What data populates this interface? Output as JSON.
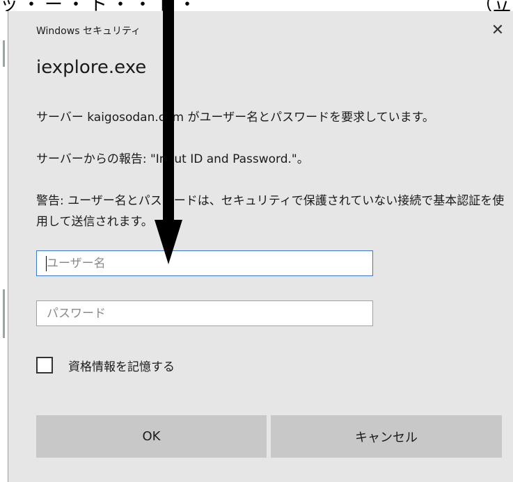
{
  "top_fragment": {
    "left_text": "ッ・ー・ト・・ト・",
    "right_text": "（立"
  },
  "dialog": {
    "app_title": "Windows セキュリティ",
    "close_glyph": "✕",
    "exe_title": "iexplore.exe",
    "message_1": "サーバー kaigosodan.com がユーザー名とパスワードを要求しています。",
    "message_2": "サーバーからの報告: \"Input ID and Password.\"。",
    "message_3": "警告: ユーザー名とパスワードは、セキュリティで保護されていない接続で基本認証を使用して送信されます。",
    "username": {
      "placeholder": "ユーザー名",
      "value": ""
    },
    "password": {
      "placeholder": "パスワード",
      "value": ""
    },
    "remember_label": "資格情報を記憶する",
    "ok_label": "OK",
    "cancel_label": "キャンセル"
  },
  "colors": {
    "dialog_bg": "#e6e6e6",
    "button_bg": "#c8c8c8",
    "focus_border": "#3b78c9"
  },
  "icons": {
    "close": "close-icon",
    "annotation": "down-arrow-icon"
  }
}
